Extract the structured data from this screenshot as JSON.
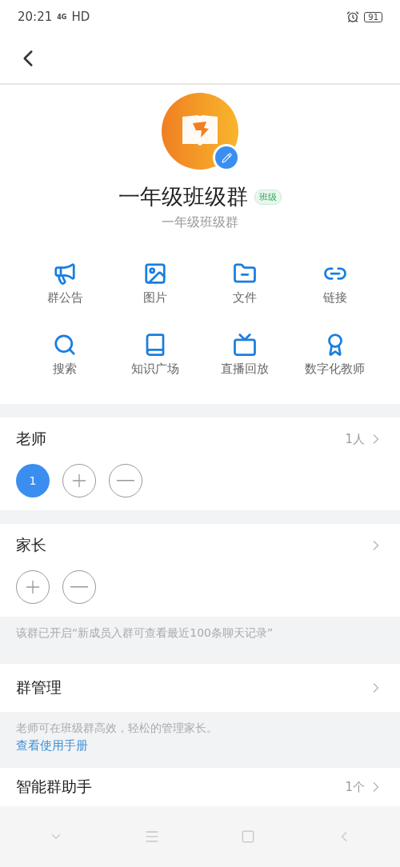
{
  "status_bar": {
    "time": "20:21",
    "network": "4G",
    "hd": "HD",
    "battery": "91"
  },
  "group": {
    "name": "一年级班级群",
    "tag": "班级",
    "subtitle": "一年级班级群"
  },
  "actions": [
    {
      "label": "群公告",
      "kind": "megaphone"
    },
    {
      "label": "图片",
      "kind": "image"
    },
    {
      "label": "文件",
      "kind": "folder"
    },
    {
      "label": "链接",
      "kind": "link"
    },
    {
      "label": "搜索",
      "kind": "search"
    },
    {
      "label": "知识广场",
      "kind": "book"
    },
    {
      "label": "直播回放",
      "kind": "tv"
    },
    {
      "label": "数字化教师",
      "kind": "award"
    }
  ],
  "teachers": {
    "title": "老师",
    "count": "1人",
    "members": [
      {
        "label": "1"
      }
    ]
  },
  "parents": {
    "title": "家长"
  },
  "notice": "该群已开启“新成员入群可查看最近100条聊天记录”",
  "management": {
    "title": "群管理",
    "description": "老师可在班级群高效，轻松的管理家长。",
    "link": "查看使用手册"
  },
  "assistant": {
    "title": "智能群助手",
    "count": "1个"
  }
}
